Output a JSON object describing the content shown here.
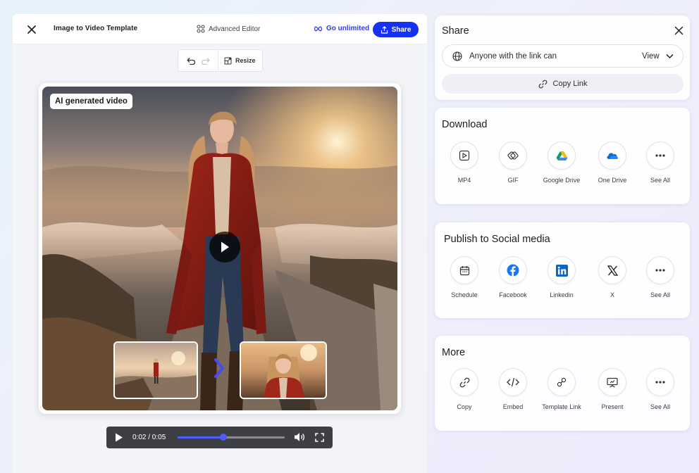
{
  "editor": {
    "title": "Image to Video Template",
    "advanced_label": "Advanced Editor",
    "go_unlimited_label": "Go unlimited",
    "share_label": "Share",
    "resize_label": "Resize",
    "badge": "AI generated video",
    "time": "0:02 / 0:05",
    "progress_fraction": 0.43
  },
  "share_panel": {
    "title": "Share",
    "access_label": "Anyone with the link can",
    "permission": "View",
    "copy_link_label": "Copy Link"
  },
  "download": {
    "title": "Download",
    "options": [
      {
        "label": "MP4",
        "icon": "video-file-icon"
      },
      {
        "label": "GIF",
        "icon": "gif-icon"
      },
      {
        "label": "Google Drive",
        "icon": "google-drive-icon"
      },
      {
        "label": "One Drive",
        "icon": "onedrive-icon"
      },
      {
        "label": "See All",
        "icon": "more-icon"
      }
    ]
  },
  "social": {
    "title": "Publish to Social media",
    "options": [
      {
        "label": "Schedule",
        "icon": "calendar-icon"
      },
      {
        "label": "Facebook",
        "icon": "facebook-icon"
      },
      {
        "label": "Linkedin",
        "icon": "linkedin-icon"
      },
      {
        "label": "X",
        "icon": "x-icon"
      },
      {
        "label": "See All",
        "icon": "more-icon"
      }
    ]
  },
  "more": {
    "title": "More",
    "options": [
      {
        "label": "Copy",
        "icon": "copy-link-icon"
      },
      {
        "label": "Embed",
        "icon": "code-icon"
      },
      {
        "label": "Template Link",
        "icon": "template-link-icon"
      },
      {
        "label": "Present",
        "icon": "present-icon"
      },
      {
        "label": "See All",
        "icon": "more-icon"
      }
    ]
  },
  "colors": {
    "accent": "#1431f4",
    "facebook": "#1877f2",
    "linkedin": "#0a66c2",
    "progress": "#4f5bff"
  }
}
